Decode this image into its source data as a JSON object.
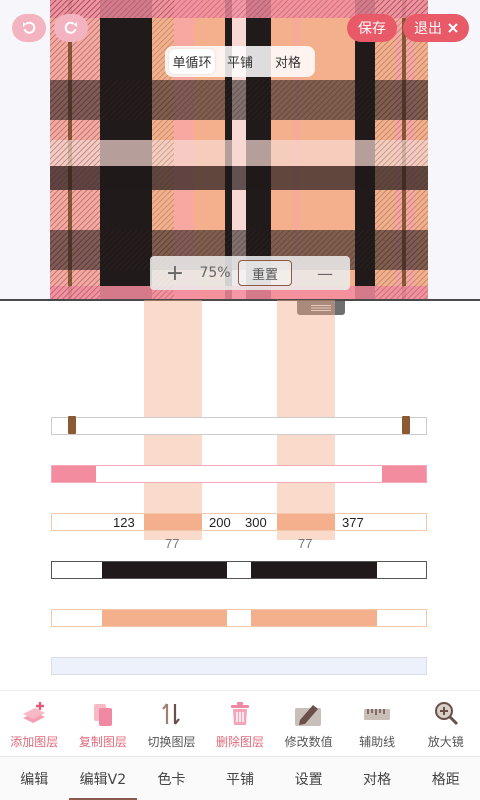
{
  "preview": {
    "save_label": "保存",
    "exit_label": "退出",
    "modes": [
      "单循环",
      "平铺",
      "对格"
    ],
    "active_mode": 0,
    "zoom": {
      "plus": "+",
      "level": "75%",
      "reset": "重置",
      "minus": "—"
    }
  },
  "editor": {
    "stripe_a": {
      "start": "123",
      "end": "200",
      "width": "77"
    },
    "stripe_b": {
      "start": "300",
      "end": "377",
      "width": "77"
    }
  },
  "colors": {
    "peach": "#f4b08c",
    "pink": "#f48ca0",
    "black": "#211a1a",
    "brown": "#8a5a34",
    "accent_red": "#e85a68",
    "light_blue": "#edf1fb"
  },
  "toolbar": [
    {
      "label": "添加图层",
      "icon": "add-layer-icon"
    },
    {
      "label": "复制图层",
      "icon": "copy-layer-icon"
    },
    {
      "label": "切换图层",
      "icon": "switch-layer-icon"
    },
    {
      "label": "删除图层",
      "icon": "delete-layer-icon"
    },
    {
      "label": "修改数值",
      "icon": "edit-value-icon"
    },
    {
      "label": "辅助线",
      "icon": "ruler-icon"
    },
    {
      "label": "放大镜",
      "icon": "magnifier-icon"
    }
  ],
  "tabs": [
    "编辑",
    "编辑V2",
    "色卡",
    "平铺",
    "设置",
    "对格",
    "格距"
  ],
  "active_tab": 1
}
